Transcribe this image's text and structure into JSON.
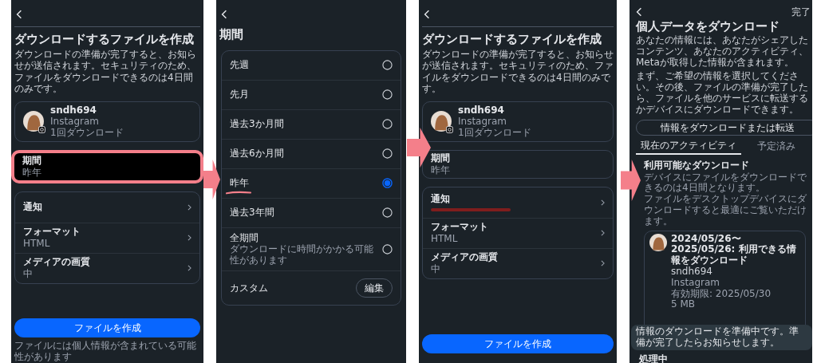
{
  "panels": [
    {
      "kind": "create",
      "title": "ダウンロードするファイルを作成",
      "description": "ダウンロードの準備が完了すると、お知らせが送信されます。セキュリティのため、ファイルをダウンロードできるのは4日間のみです。",
      "account": {
        "name": "sndh694",
        "app": "Instagram",
        "downloads": "1回ダウンロード"
      },
      "period": {
        "label": "期間",
        "value": "昨年",
        "highlighted": true
      },
      "options": [
        {
          "label": "通知",
          "redacted": false
        },
        {
          "label": "フォーマット",
          "value": "HTML",
          "redacted": false
        },
        {
          "label": "メディアの画質",
          "value": "中",
          "redacted": false
        }
      ],
      "button": "ファイルを作成",
      "footer": "ファイルには個人情報が含まれている可能性があります"
    },
    {
      "kind": "period",
      "title": "期間",
      "options": [
        {
          "label": "先週",
          "selected": false
        },
        {
          "label": "先月",
          "selected": false
        },
        {
          "label": "過去3か月間",
          "selected": false
        },
        {
          "label": "過去6か月間",
          "selected": false
        },
        {
          "label": "昨年",
          "selected": true
        },
        {
          "label": "過去3年間",
          "selected": false
        },
        {
          "label": "全期間",
          "note": "ダウンロードに時間がかかる可能性があります",
          "selected": false
        }
      ],
      "custom": {
        "label": "カスタム",
        "button": "編集"
      }
    },
    {
      "kind": "create",
      "title": "ダウンロードするファイルを作成",
      "description": "ダウンロードの準備が完了すると、お知らせが送信されます。セキュリティのため、ファイルをダウンロードできるのは4日間のみです。",
      "account": {
        "name": "sndh694",
        "app": "Instagram",
        "downloads": "1回ダウンロード"
      },
      "period": {
        "label": "期間",
        "value": "昨年",
        "highlighted": false
      },
      "options": [
        {
          "label": "通知",
          "redacted": true
        },
        {
          "label": "フォーマット",
          "value": "HTML",
          "redacted": false
        },
        {
          "label": "メディアの画質",
          "value": "中",
          "redacted": false
        }
      ],
      "button": "ファイルを作成"
    },
    {
      "kind": "overview",
      "done": "完了",
      "title": "個人データをダウンロード",
      "paragraphs": [
        "あなたの情報には、あなたがシェアしたコンテンツ、あなたのアクティビティ、Metaが取得した情報が含まれます。",
        "まず、ご希望の情報を選択してください。その後、ファイルの準備が完了したら、ファイルを他のサービスに転送するかデバイスにダウンロードできます。"
      ],
      "button": "情報をダウンロードまたは転送",
      "tabs": [
        {
          "label": "現在のアクティビティ",
          "selected": true
        },
        {
          "label": "予定済み",
          "selected": false
        }
      ],
      "section_title": "利用可能なダウンロード",
      "section_notes": [
        "デバイスにファイルをダウンロードできるのは4日間となります。",
        "ファイルをデスクトップデバイスにダウンロードすると最適にご覧いただけます。"
      ],
      "download": {
        "title": "2024/05/26〜2025/05/26: 利用できる情報をダウンロード",
        "account": "sndh694",
        "app": "Instagram",
        "expiry": "有効期限: 2025/05/30",
        "size": "5 MB"
      },
      "toast": "情報のダウンロードを準備中です。準備が完了したらお知らせします。",
      "status": "処理中"
    }
  ]
}
